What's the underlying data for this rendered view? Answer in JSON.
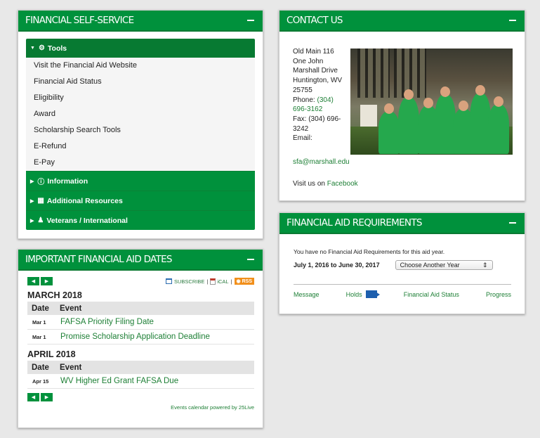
{
  "fss": {
    "title": "FINANCIAL SELF-SERVICE",
    "tools_label": "Tools",
    "tools_items": [
      "Visit the Financial Aid Website",
      "Financial Aid Status",
      "Eligibility",
      "Award",
      "Scholarship Search Tools",
      "E-Refund",
      "E-Pay"
    ],
    "sections": [
      "Information",
      "Additional Resources",
      "Veterans / International"
    ]
  },
  "dates": {
    "title": "IMPORTANT FINANCIAL AID DATES",
    "subscribe": "SUBSCRIBE",
    "ical": "iCAL",
    "rss": "RSS",
    "col_date": "Date",
    "col_event": "Event",
    "months": [
      {
        "name": "MARCH 2018",
        "events": [
          {
            "date": "Mar 1",
            "event": "FAFSA Priority Filing Date"
          },
          {
            "date": "Mar 1",
            "event": "Promise Scholarship Application Deadline"
          }
        ]
      },
      {
        "name": "APRIL 2018",
        "events": [
          {
            "date": "Apr 15",
            "event": "WV Higher Ed Grant FAFSA Due"
          }
        ]
      }
    ],
    "powered_by": "Events calendar powered by 25Live"
  },
  "contact": {
    "title": "CONTACT US",
    "address_lines": [
      "Old Main 116",
      "One John",
      "Marshall Drive",
      "Huntington, WV",
      "25755"
    ],
    "phone_label": "Phone:",
    "phone_a": "(304)",
    "phone_b": "696-3162",
    "fax_a": "Fax: (304) 696-",
    "fax_b": "3242",
    "email_label": "Email:",
    "email": "sfa@marshall.edu",
    "visit_label": "Visit us on",
    "facebook": "Facebook"
  },
  "requirements": {
    "title": "FINANCIAL AID REQUIREMENTS",
    "message": "You have no Financial Aid Requirements for this aid year.",
    "aid_year": "July 1, 2016 to June 30, 2017",
    "year_select": "Choose Another Year",
    "links": [
      "Message",
      "Holds",
      "Financial Aid Status",
      "Progress"
    ]
  }
}
